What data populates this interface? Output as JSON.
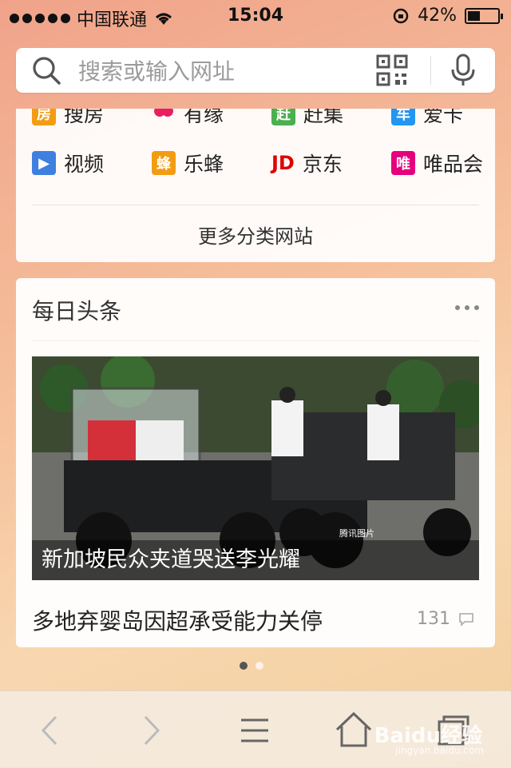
{
  "status": {
    "carrier": "中国联通",
    "time": "15:04",
    "battery_percent": "42%",
    "battery_level": 0.42
  },
  "search": {
    "placeholder": "搜索或输入网址"
  },
  "sites": {
    "row1": [
      {
        "label": "搜房",
        "icon_text": "房",
        "color": "#f39c12"
      },
      {
        "label": "有缘",
        "icon_text": "",
        "color": "#e91e63"
      },
      {
        "label": "赶集",
        "icon_text": "赶",
        "color": "#4caf50"
      },
      {
        "label": "爱卡",
        "icon_text": "车",
        "color": "#2196f3"
      }
    ],
    "row2": [
      {
        "label": "视频",
        "icon_text": "▶",
        "color": "#3f7fe0"
      },
      {
        "label": "乐蜂",
        "icon_text": "蜂",
        "color": "#f39c12"
      },
      {
        "label": "京东",
        "icon_text": "JD",
        "color": "#e00000"
      },
      {
        "label": "唯品会",
        "icon_text": "唯",
        "color": "#e6007e"
      }
    ],
    "more": "更多分类网站"
  },
  "feed": {
    "title": "每日头条",
    "headline": "新加坡民众夹道哭送李光耀",
    "photo_watermark": "腾讯图片",
    "item2": {
      "title": "多地弃婴岛因超承受能力关停",
      "comments": "131"
    }
  },
  "pager": {
    "active": 0,
    "count": 2
  },
  "watermark": {
    "brand": "Baidu经验",
    "url": "jingyan.baidu.com"
  }
}
